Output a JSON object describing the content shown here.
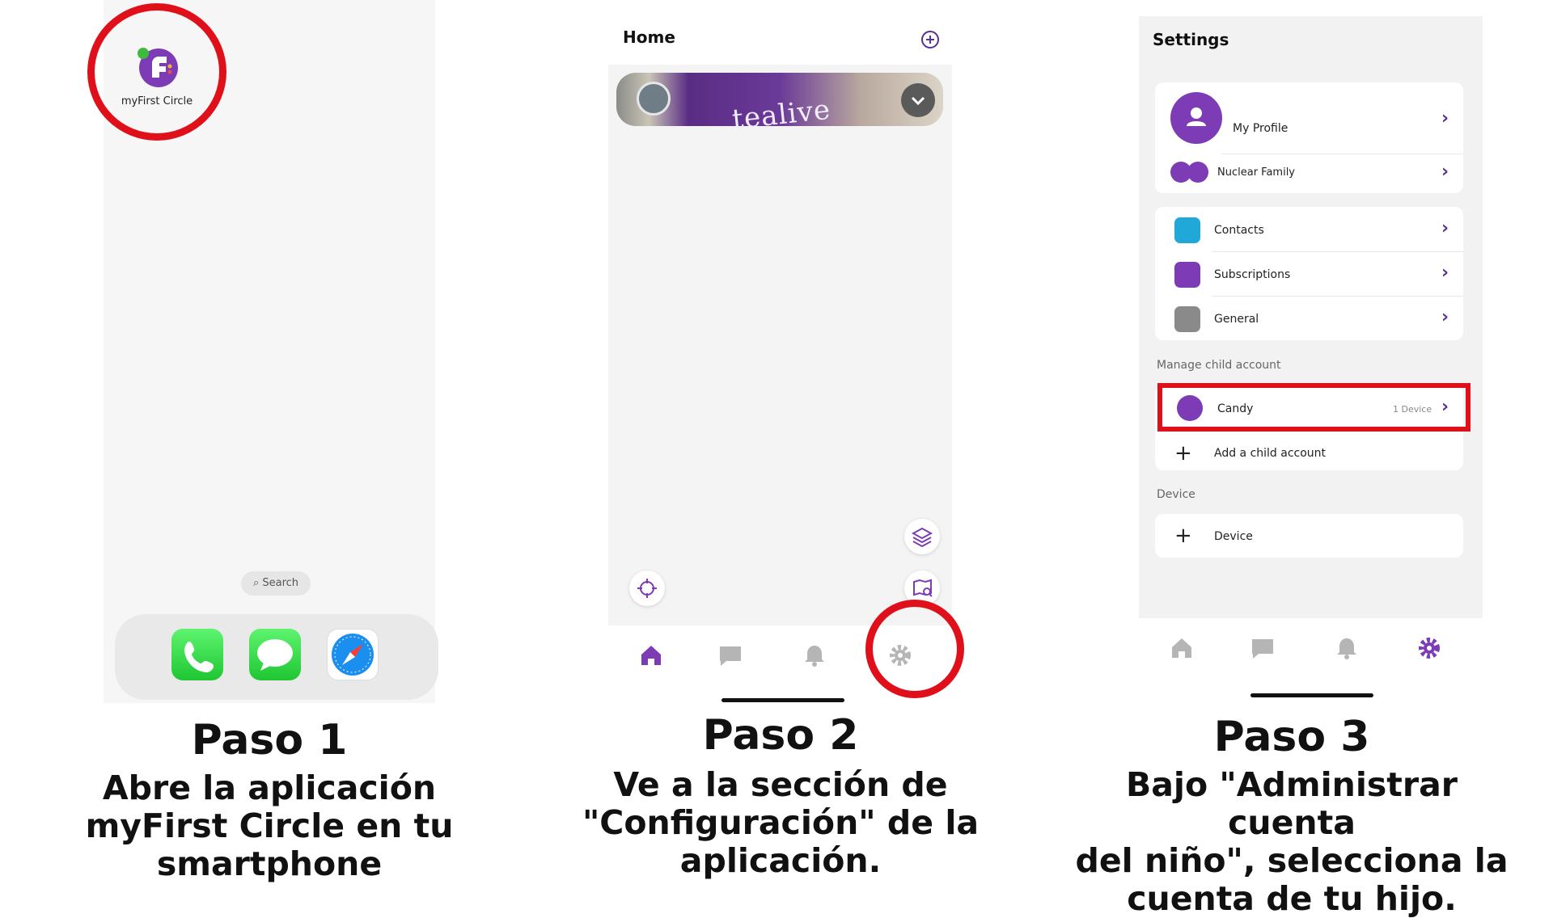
{
  "colors": {
    "brand_purple": "#7d3cb6",
    "highlight_red": "#e0101a",
    "icon_gray": "#b5b5b5"
  },
  "panel1": {
    "app_label": "myFirst Circle",
    "search_label": "Search",
    "dock_icons": [
      "phone-icon",
      "messages-icon",
      "safari-icon"
    ],
    "caption_title": "Paso 1",
    "caption_lines": [
      "Abre la aplicación",
      "myFirst Circle en tu",
      "smartphone"
    ]
  },
  "panel2": {
    "title": "Home",
    "card_text": "tealive",
    "tabs": [
      "home-icon",
      "chat-icon",
      "bell-icon",
      "gear-icon"
    ],
    "active_tab": "home",
    "caption_title": "Paso 2",
    "caption_lines": [
      "Ve a la sección de",
      "\"Configuración\" de la",
      "aplicación."
    ]
  },
  "panel3": {
    "title": "Settings",
    "profile": {
      "label": "My Profile",
      "family_label": "Nuclear Family"
    },
    "menu": {
      "contacts": "Contacts",
      "subscriptions": "Subscriptions",
      "general": "General"
    },
    "manage_child_header": "Manage child account",
    "child": {
      "name": "Candy",
      "device_count": "1 Device"
    },
    "add_child_label": "Add a child account",
    "device_header": "Device",
    "device_label": "Device",
    "tabs": [
      "home-icon",
      "chat-icon",
      "bell-icon",
      "gear-icon"
    ],
    "active_tab": "settings",
    "caption_title": "Paso 3",
    "caption_lines": [
      "Bajo \"Administrar cuenta",
      "del niño\", selecciona la",
      "cuenta de tu hijo."
    ]
  }
}
